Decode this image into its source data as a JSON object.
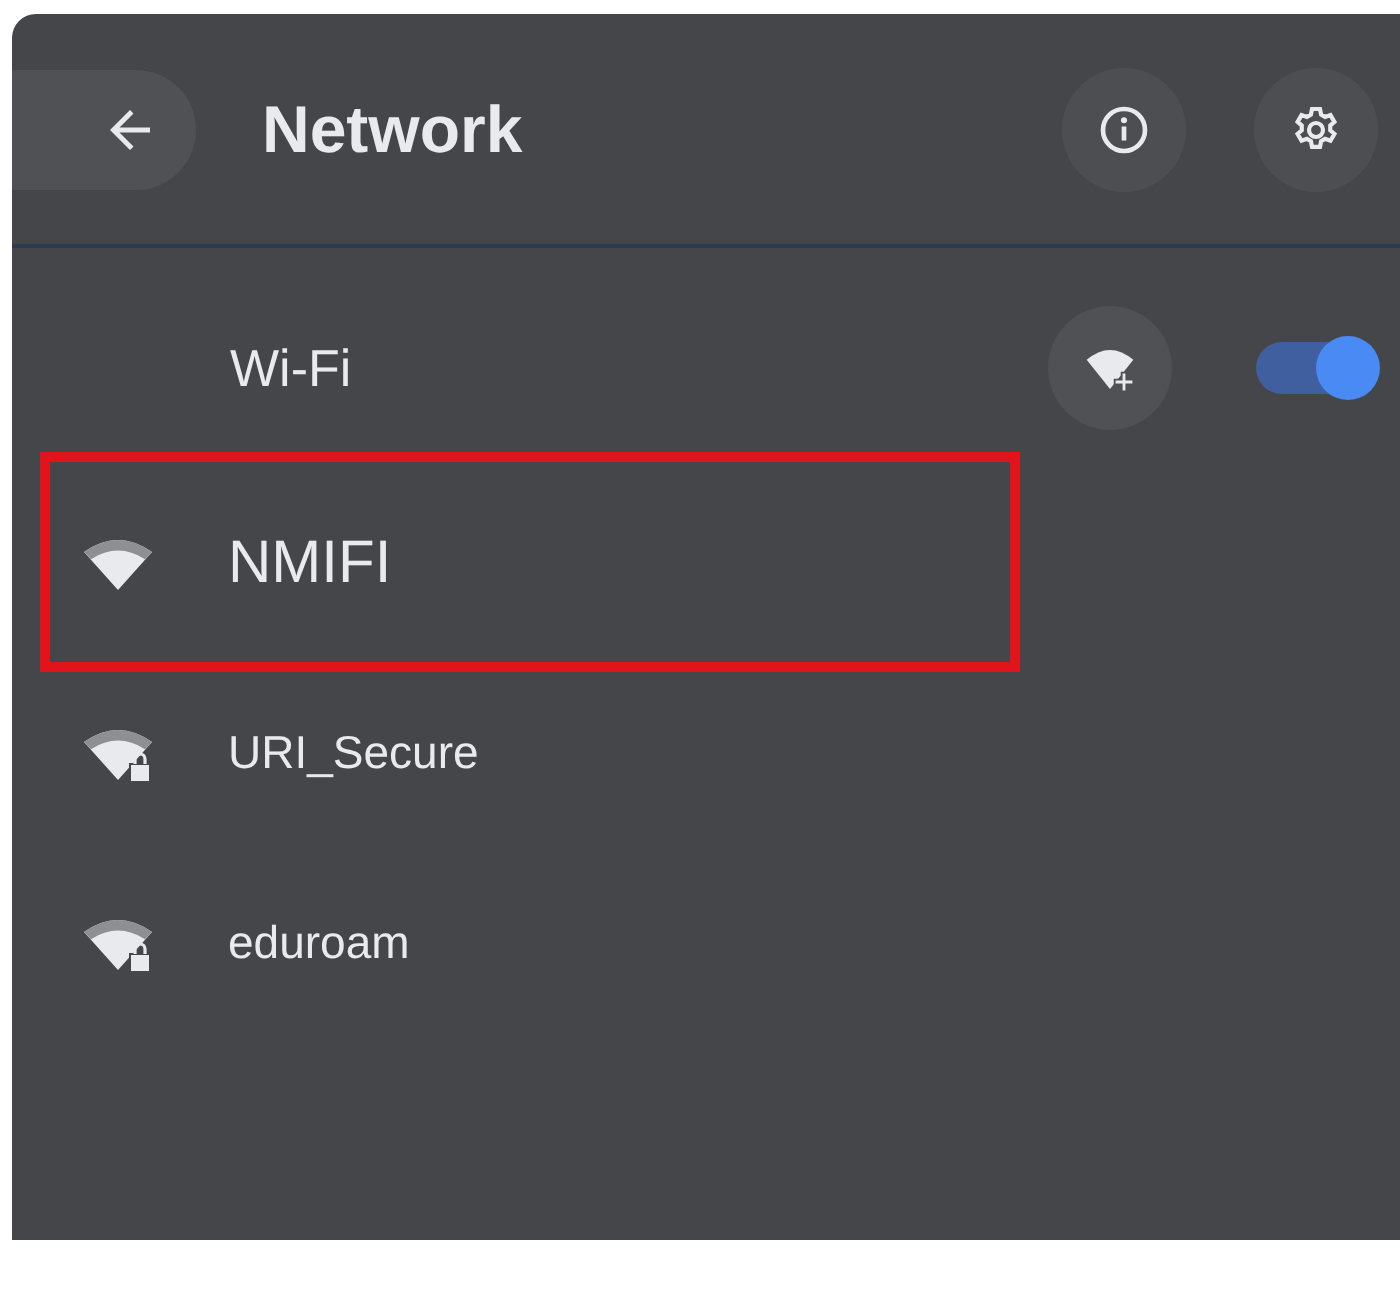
{
  "header": {
    "title": "Network"
  },
  "wifi": {
    "label": "Wi-Fi",
    "on": true
  },
  "networks": [
    {
      "name": "NMIFI",
      "secured": false,
      "highlighted": true
    },
    {
      "name": "URI_Secure",
      "secured": true,
      "highlighted": false
    },
    {
      "name": "eduroam",
      "secured": true,
      "highlighted": false
    }
  ]
}
